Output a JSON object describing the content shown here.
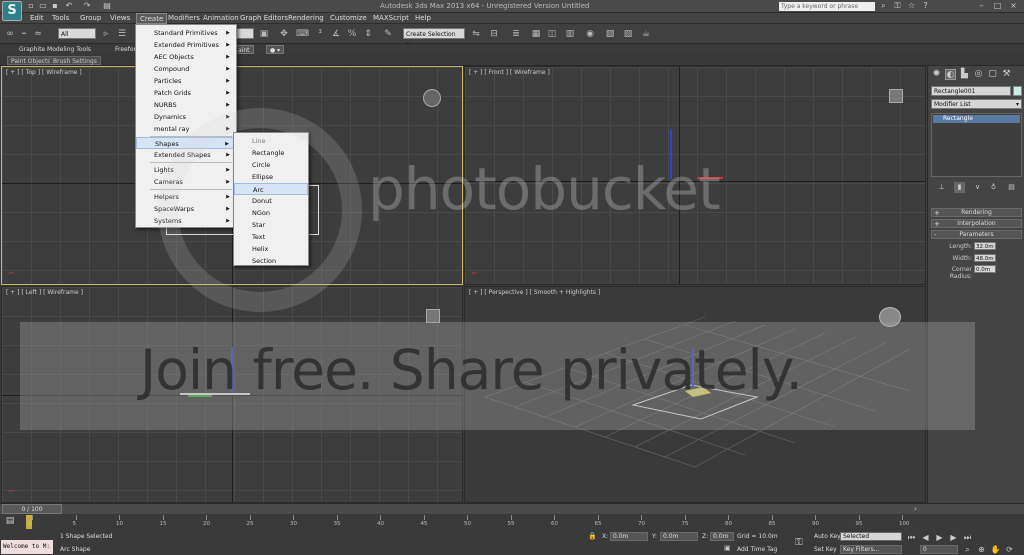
{
  "title_bar": {
    "title": "Autodesk 3ds Max 2013 x64 - Unregistered Version   Untitled",
    "search_placeholder": "Type a keyword or phrase",
    "app_icon": "3ds-max-logo"
  },
  "menubar": {
    "items": [
      "Edit",
      "Tools",
      "Group",
      "Views",
      "Create",
      "Modifiers",
      "Animation",
      "Graph Editors",
      "Rendering",
      "Customize",
      "MAXScript",
      "Help"
    ],
    "active": "Create"
  },
  "toolbar": {
    "selection_filter": "All",
    "named_selection": "Create Selection Se"
  },
  "ribbon": {
    "tabs": [
      "Graphite Modeling Tools",
      "Freeform",
      "aint"
    ],
    "subtabs": [
      "Paint Objects",
      "Brush Settings"
    ]
  },
  "create_menu": {
    "items": [
      {
        "label": "Standard Primitives",
        "sub": true
      },
      {
        "label": "Extended Primitives",
        "sub": true
      },
      {
        "label": "AEC Objects",
        "sub": true
      },
      {
        "label": "Compound",
        "sub": true
      },
      {
        "label": "Particles",
        "sub": true
      },
      {
        "label": "Patch Grids",
        "sub": true
      },
      {
        "label": "NURBS",
        "sub": true
      },
      {
        "label": "Dynamics",
        "sub": true
      },
      {
        "label": "mental ray",
        "sub": true
      },
      {
        "label": "Shapes",
        "sub": true
      },
      {
        "label": "Extended Shapes",
        "sub": true
      },
      {
        "label": "Lights",
        "sub": true
      },
      {
        "label": "Cameras",
        "sub": true
      },
      {
        "label": "Helpers",
        "sub": true
      },
      {
        "label": "SpaceWarps",
        "sub": true
      },
      {
        "label": "Systems",
        "sub": true
      }
    ],
    "highlighted": "Shapes"
  },
  "shapes_submenu": {
    "items": [
      "Line",
      "Rectangle",
      "Circle",
      "Ellipse",
      "Arc",
      "Donut",
      "NGon",
      "Star",
      "Text",
      "Helix",
      "Section"
    ],
    "highlighted": "Arc"
  },
  "viewports": {
    "top": "[ + ] [ Top ] [ Wireframe ]",
    "front": "[ + ] [ Front ] [ Wireframe ]",
    "left": "[ + ] [ Left ] [ Wireframe ]",
    "perspective": "[ + ] [ Perspective ] [ Smooth + Highlights ]"
  },
  "command_panel": {
    "object_name": "Rectangle001",
    "modifier_list": "Modifier List",
    "stack_items": [
      "Rectangle"
    ],
    "rollouts": [
      "Rendering",
      "Interpolation",
      "Parameters"
    ],
    "parameters": [
      {
        "label": "Length:",
        "value": "32.0m"
      },
      {
        "label": "Width:",
        "value": "48.0m"
      },
      {
        "label": "Corner Radius:",
        "value": "0.0m"
      }
    ]
  },
  "timeline": {
    "slider": "0 / 100",
    "ticks": [
      "0",
      "5",
      "10",
      "15",
      "20",
      "25",
      "30",
      "35",
      "40",
      "45",
      "50",
      "55",
      "60",
      "65",
      "70",
      "75",
      "80",
      "85",
      "90",
      "95",
      "100"
    ]
  },
  "status": {
    "maxscript": "Welcome to M:",
    "selection": "1 Shape Selected",
    "prompt": "Arc Shape",
    "x_label": "X:",
    "x": "0.0m",
    "y_label": "Y:",
    "y": "0.0m",
    "z_label": "Z:",
    "z": "0.0m",
    "grid": "Grid = 10.0m",
    "add_time_tag": "Add Time Tag",
    "auto_key": "Auto Key",
    "set_key": "Set Key",
    "selected": "Selected",
    "key_filters": "Key Filters...",
    "frame": "0"
  },
  "watermark": {
    "brand": "photobucket",
    "slogan": "Join free. Share privately."
  }
}
